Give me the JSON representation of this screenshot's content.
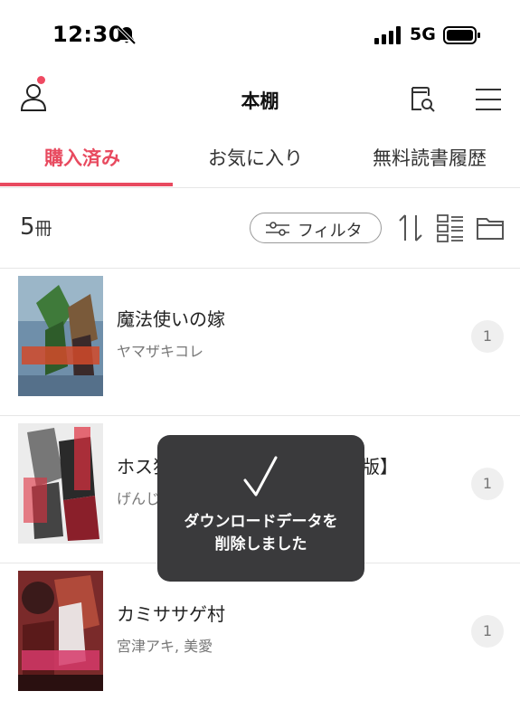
{
  "status_bar": {
    "time": "12:30",
    "network": "5G"
  },
  "nav": {
    "title": "本棚"
  },
  "tabs": [
    {
      "label": "購入済み",
      "active": true
    },
    {
      "label": "お気に入り",
      "active": false
    },
    {
      "label": "無料読書履歴",
      "active": false
    }
  ],
  "toolbar": {
    "count_number": "5",
    "count_unit": "冊",
    "filter_label": "フィルタ"
  },
  "books": [
    {
      "title": "魔法使いの嫁",
      "author": "ヤマザキコレ",
      "volume": "1"
    },
    {
      "title": "ホス狂【雑誌版】【単行本版】【全年版】",
      "title_visible_left": "ホス狂",
      "title_visible_right": "年版】",
      "author": "げんじ",
      "volume": "1"
    },
    {
      "title": "カミササゲ村",
      "author": "宮津アキ, 美愛",
      "volume": "1"
    }
  ],
  "toast": {
    "message_line1": "ダウンロードデータを",
    "message_line2": "削除しました"
  },
  "colors": {
    "accent": "#e84a5f",
    "toast_bg": "#3a3a3c",
    "badge_bg": "#efefef"
  }
}
